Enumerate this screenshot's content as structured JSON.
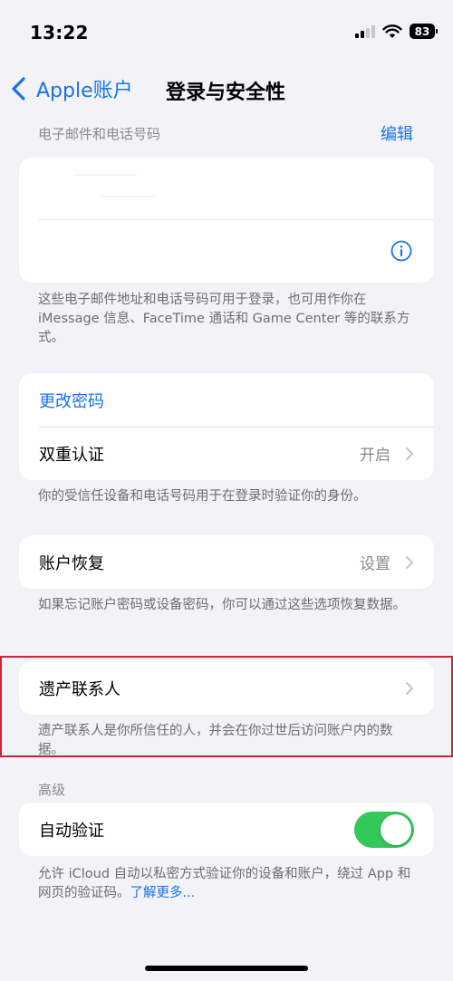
{
  "status_bar": {
    "time": "13:22",
    "battery": "83"
  },
  "nav": {
    "back_label": "Apple账户",
    "title": "登录与安全性"
  },
  "email_section": {
    "header": "电子邮件和电话号码",
    "edit_label": "编辑",
    "note": "这些电子邮件地址和电话号码可用于登录，也可用作你在 iMessage 信息、FaceTime 通话和 Game Center 等的联系方式。"
  },
  "security": {
    "change_password": "更改密码",
    "two_factor_label": "双重认证",
    "two_factor_value": "开启",
    "note": "你的受信任设备和电话号码用于在登录时验证你的身份。"
  },
  "recovery": {
    "label": "账户恢复",
    "value": "设置",
    "note": "如果忘记账户密码或设备密码，你可以通过这些选项恢复数据。"
  },
  "legacy": {
    "label": "遗产联系人",
    "note": "遗产联系人是你所信任的人，并会在你过世后访问账户内的数据。"
  },
  "advanced": {
    "header": "高级",
    "auto_verify_label": "自动验证",
    "auto_verify_on": true,
    "note": "允许 iCloud 自动以私密方式验证你的设备和账户，绕过 App 和网页的验证码。",
    "learn_more": "了解更多..."
  },
  "colors": {
    "accent": "#1a73e8",
    "toggle_on": "#34c759",
    "highlight": "#c8253a"
  }
}
